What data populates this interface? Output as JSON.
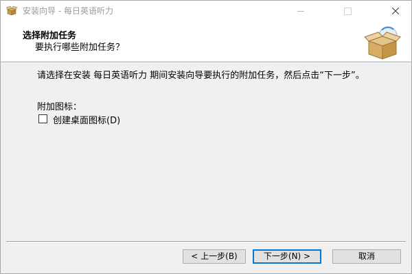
{
  "window": {
    "title": "安装向导 - 每日英语听力",
    "controls": {
      "minimize_icon": "minimize-icon",
      "maximize_icon": "maximize-icon",
      "close_icon": "close-icon"
    }
  },
  "header": {
    "title": "选择附加任务",
    "subtitle": "要执行哪些附加任务？",
    "image_icon": "package-box-icon"
  },
  "body": {
    "instruction": "请选择在安装 每日英语听力 期间安装向导要执行的附加任务，然后点击“下一步”。",
    "additional_icons_label": "附加图标：",
    "checkbox": {
      "label": "创建桌面图标(D)",
      "checked": false
    }
  },
  "footer": {
    "back_label": "< 上一步(B)",
    "next_label": "下一步(N) >",
    "cancel_label": "取消"
  },
  "colors": {
    "window_bg": "#f0f0f0",
    "header_bg": "#ffffff",
    "accent": "#0078d7",
    "button_bg": "#e1e1e1"
  }
}
